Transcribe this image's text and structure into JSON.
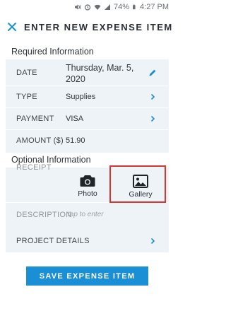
{
  "status_bar": {
    "battery_percent": "74%",
    "time": "4:27 PM"
  },
  "header": {
    "title": "ENTER NEW EXPENSE ITEM"
  },
  "required": {
    "section_title": "Required Information",
    "date_label": "DATE",
    "date_value_line1": "Thursday, Mar. 5,",
    "date_value_line2": "2020",
    "type_label": "TYPE",
    "type_value": "Supplies",
    "payment_label": "PAYMENT",
    "payment_value": "VISA",
    "amount_label": "AMOUNT ($)",
    "amount_value": "51.90"
  },
  "optional": {
    "section_title": "Optional Information",
    "receipt_label": "RECEIPT",
    "photo_label": "Photo",
    "gallery_label": "Gallery",
    "description_label": "DESCRIPTION",
    "description_placeholder": "tap to enter",
    "project_details_label": "PROJECT DETAILS"
  },
  "actions": {
    "save_label": "SAVE EXPENSE ITEM"
  },
  "colors": {
    "accent": "#1b8fd6",
    "row_bg": "#eef3f7",
    "highlight": "#d9342f"
  }
}
